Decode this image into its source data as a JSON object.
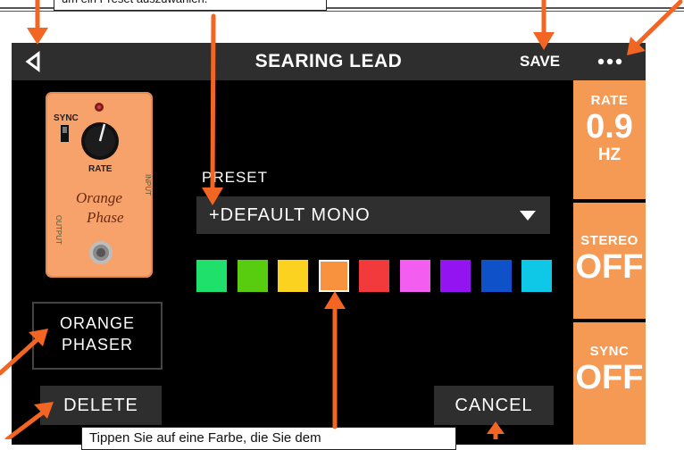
{
  "callouts": {
    "top": "um ein Preset auszuwählen.",
    "bottom": "Tippen Sie auf eine Farbe, die Sie dem"
  },
  "header": {
    "title": "SEARING LEAD",
    "save_label": "SAVE",
    "back_icon": "back-triangle-icon",
    "more_icon": "more-dots-icon"
  },
  "pedal": {
    "sync_label": "SYNC",
    "rate_label": "RATE",
    "output_label": "OUTPUT",
    "input_label": "INPUT",
    "brand_line1": "Orange",
    "brand_line2": "Phase",
    "body_color": "#f7a16b"
  },
  "model_name": {
    "line1": "ORANGE",
    "line2": "PHASER"
  },
  "buttons": {
    "delete": "DELETE",
    "cancel": "CANCEL"
  },
  "preset": {
    "label": "PRESET",
    "selected": "+DEFAULT MONO"
  },
  "swatches": [
    {
      "color": "#1fe06a",
      "selected": false
    },
    {
      "color": "#58cc0e",
      "selected": false
    },
    {
      "color": "#fbd21f",
      "selected": false
    },
    {
      "color": "#f8923f",
      "selected": true
    },
    {
      "color": "#f2393b",
      "selected": false
    },
    {
      "color": "#f45ef0",
      "selected": false
    },
    {
      "color": "#9313f1",
      "selected": false
    },
    {
      "color": "#0f51c8",
      "selected": false
    },
    {
      "color": "#0fc7e7",
      "selected": false
    }
  ],
  "params": [
    {
      "label": "RATE",
      "value": "0.9",
      "unit": "HZ"
    },
    {
      "label": "STEREO",
      "value": "OFF",
      "unit": ""
    },
    {
      "label": "SYNC",
      "value": "OFF",
      "unit": ""
    }
  ],
  "colors": {
    "accent": "#f59a55",
    "arrow": "#f26522",
    "bar": "#2e2e2e"
  }
}
